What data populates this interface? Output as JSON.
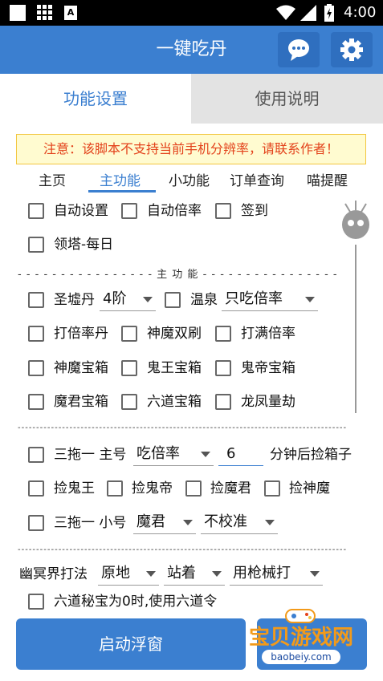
{
  "status": {
    "time": "4:00"
  },
  "app": {
    "title": "一键吃丹"
  },
  "tabs": [
    "功能设置",
    "使用说明"
  ],
  "notice": "注意：该脚本不支持当前手机分辨率，请联系作者！",
  "subtabs": [
    "主页",
    "主功能",
    "小功能",
    "订单查询",
    "喵提醒"
  ],
  "opts": {
    "auto_settings": "自动设置",
    "auto_rate": "自动倍率",
    "signin": "签到",
    "tower": "领塔-每日",
    "sec_main": "- - - - - - - - - - - - - - - - 主 功 能 - - - - - - - - - - - - - - - -",
    "shengxu": "圣墟丹",
    "shengxu_sel": "4阶",
    "wenquan": "温泉",
    "wenquan_sel": "只吃倍率",
    "dabei": "打倍率丹",
    "shenmo_double": "神魔双刷",
    "daman": "打满倍率",
    "shenmo_box": "神魔宝箱",
    "guiwang_box": "鬼王宝箱",
    "guidi_box": "鬼帝宝箱",
    "mojun_box": "魔君宝箱",
    "liudao_box": "六道宝箱",
    "longfeng": "龙凤量劫",
    "sec_line": "------------------------------------------------------------------------------------------------",
    "santuo_main": "三拖一 主号",
    "santuo_main_sel": "吃倍率",
    "minutes": "6",
    "after": "分钟后捡箱子",
    "pick_guiwang": "捡鬼王",
    "pick_guidi": "捡鬼帝",
    "pick_mojun": "捡魔君",
    "pick_shenmo": "捡神魔",
    "santuo_small": "三拖一 小号",
    "small_sel1": "魔君",
    "small_sel2": "不校准",
    "sec_line2": "------------------------------------------------------------------------------------------------",
    "youming": "幽冥界打法",
    "ym_sel1": "原地",
    "ym_sel2": "站着",
    "ym_sel3": "用枪械打",
    "liudao_mibao": "六道秘宝为0时,使用六道令"
  },
  "buttons": {
    "start": "启动浮窗"
  },
  "watermark": {
    "name": "宝贝游戏网",
    "url": "baobeiy.com"
  },
  "colors": {
    "primary": "#3b7fd0",
    "notice_text": "#e3421b"
  }
}
